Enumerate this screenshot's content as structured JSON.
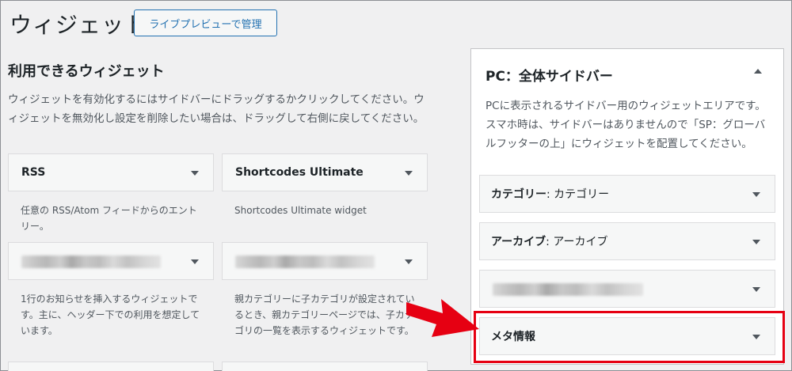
{
  "header": {
    "title": "ウィジェット",
    "preview_button": "ライブプレビューで管理"
  },
  "available": {
    "title": "利用できるウィジェット",
    "description": "ウィジェットを有効化するにはサイドバーにドラッグするかクリックしてください。ウィジェットを無効化し設定を削除したい場合は、ドラッグして右側に戻してください。",
    "widgets": [
      {
        "title": "RSS",
        "description": "任意の RSS/Atom フィードからのエントリー。"
      },
      {
        "title": "Shortcodes Ultimate",
        "description": "Shortcodes Ultimate widget"
      },
      {
        "title": "",
        "description": "1行のお知らせを挿入するウィジェットです。主に、ヘッダー下での利用を想定しています。"
      },
      {
        "title": "",
        "description": "親カテゴリーに子カテゴリが設定されているとき、親カテゴリーページでは、子カテゴリの一覧を表示するウィジェットです。"
      }
    ]
  },
  "sidebar": {
    "title": "PC：全体サイドバー",
    "description": "PCに表示されるサイドバー用のウィジェットエリアです。スマホ時は、サイドバーはありませんので「SP：グローバルフッターの上」にウィジェットを配置してください。",
    "widgets": [
      {
        "name": "カテゴリー",
        "sep": ": ",
        "title": "カテゴリー"
      },
      {
        "name": "アーカイブ",
        "sep": ": ",
        "title": "アーカイブ"
      },
      {
        "name": "",
        "sep": "",
        "title": ""
      },
      {
        "name": "メタ情報",
        "sep": "",
        "title": ""
      }
    ]
  },
  "icons": {
    "widget_toggle": "caret-down-icon",
    "sidebar_toggle": "caret-up-icon",
    "pointer": "red-arrow-icon"
  },
  "colors": {
    "accent": "#2271b1",
    "highlight": "#e60012"
  }
}
